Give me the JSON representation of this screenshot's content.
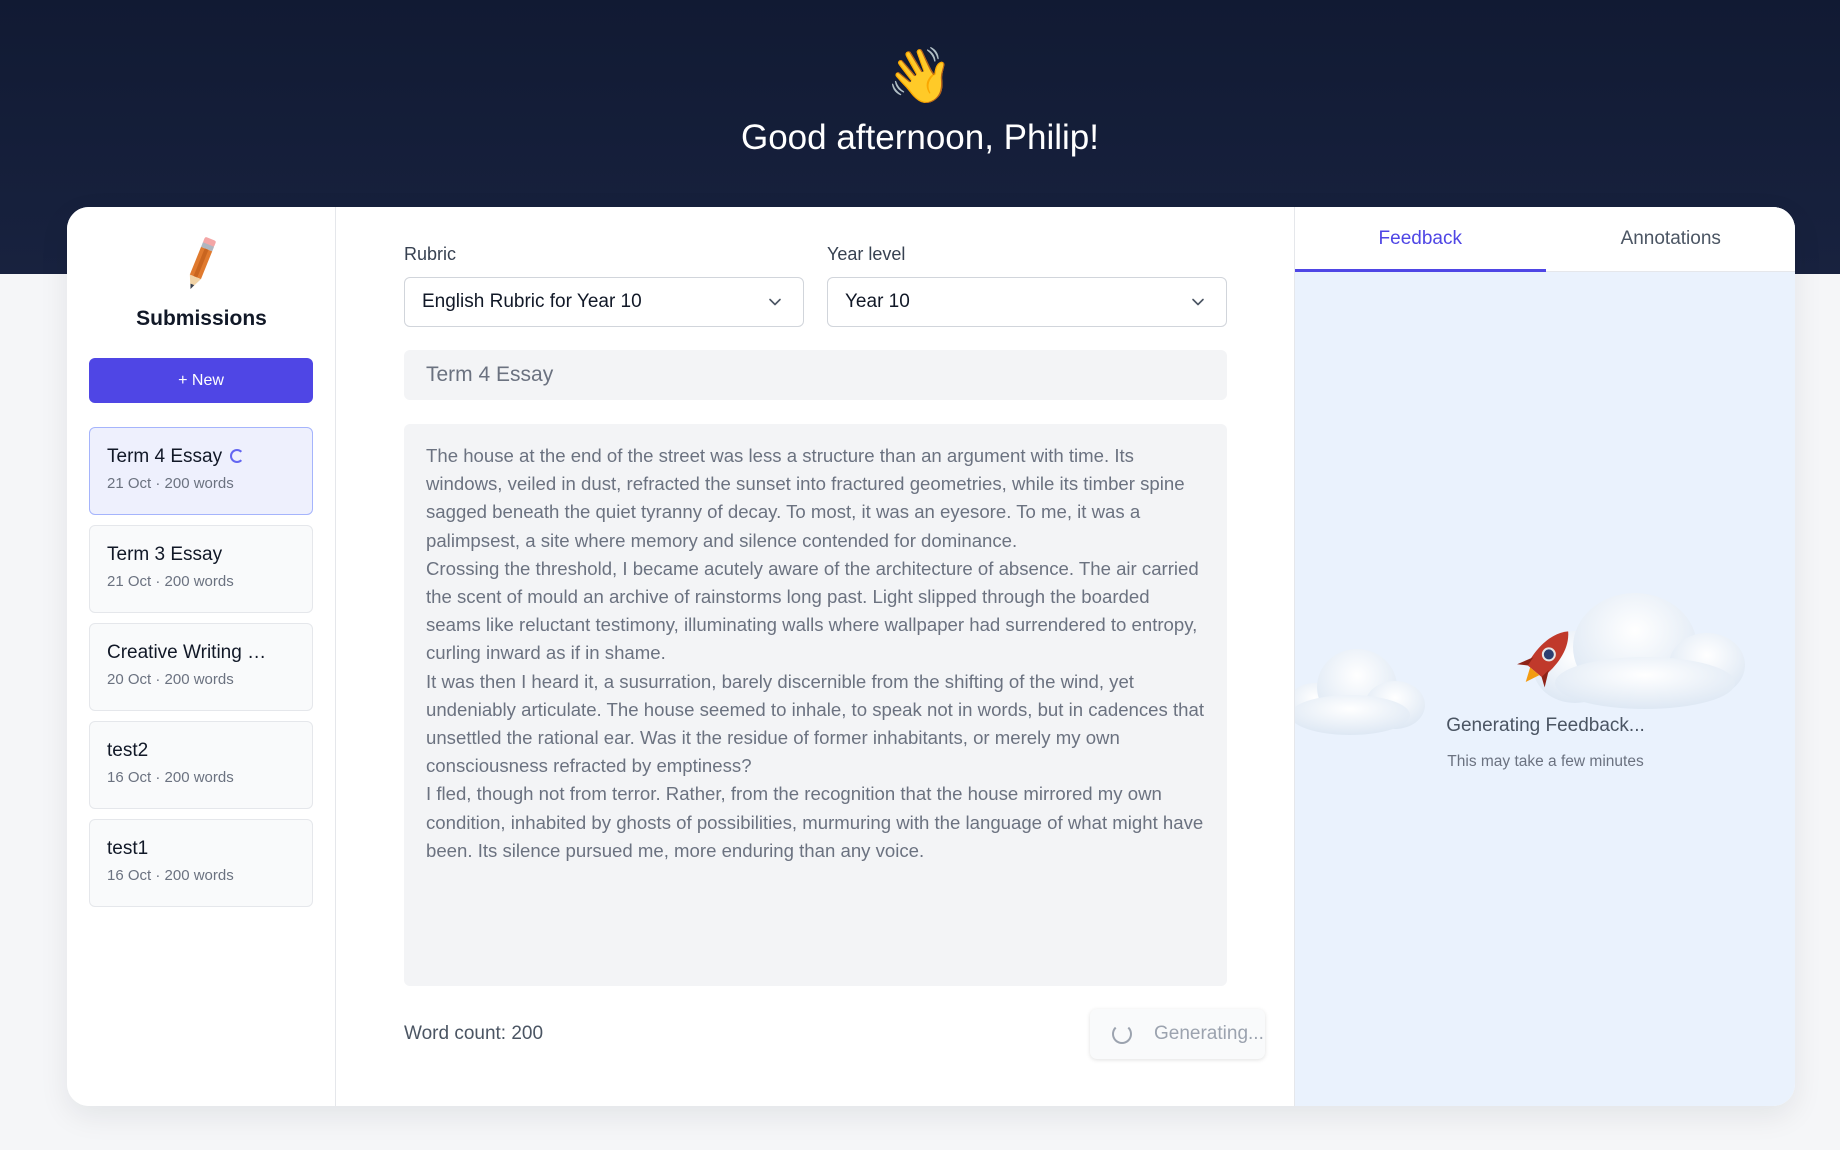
{
  "header": {
    "wave_emoji": "👋",
    "greeting": "Good afternoon, Philip!"
  },
  "sidebar": {
    "title": "Submissions",
    "new_button": "+ New",
    "items": [
      {
        "title": "Term 4 Essay",
        "meta": "21 Oct · 200 words",
        "active": true,
        "loading": true
      },
      {
        "title": "Term 3 Essay",
        "meta": "21 Oct · 200 words"
      },
      {
        "title": "Creative Writing …",
        "meta": "20 Oct · 200 words"
      },
      {
        "title": "test2",
        "meta": "16 Oct · 200 words"
      },
      {
        "title": "test1",
        "meta": "16 Oct · 200 words"
      }
    ]
  },
  "form": {
    "rubric_label": "Rubric",
    "rubric_value": "English Rubric for Year 10",
    "year_label": "Year level",
    "year_value": "Year 10",
    "title_value": "Term 4 Essay",
    "essay_paragraphs": [
      "The house at the end of the street was less a structure than an argument with time. Its windows, veiled in dust, refracted the sunset into fractured geometries, while its timber spine sagged beneath the quiet tyranny of decay. To most, it was an eyesore. To me, it was a palimpsest, a site where memory and silence contended for dominance.",
      "Crossing the threshold, I became acutely aware of the architecture of absence. The air carried the scent of mould an archive of rainstorms long past. Light slipped through the boarded seams like reluctant testimony, illuminating walls where wallpaper had surrendered to entropy, curling inward as if in shame.",
      "It was then I heard it, a susurration, barely discernible from the shifting of the wind, yet undeniably articulate. The house seemed to inhale, to speak not in words, but in cadences that unsettled the rational ear. Was it the residue of former inhabitants, or merely my own consciousness refracted by emptiness?",
      "I fled, though not from terror. Rather, from the recognition that the house mirrored my own condition, inhabited by ghosts of possibilities, murmuring with the language of what might have been. Its silence pursued me, more enduring than any voice."
    ],
    "word_count": "Word count: 200",
    "generate_button": "Generating..."
  },
  "panel": {
    "tabs": [
      "Feedback",
      "Annotations"
    ],
    "active_tab": "Feedback",
    "status_title": "Generating Feedback...",
    "status_sub": "This may take a few minutes"
  },
  "colors": {
    "hero": "#111a33",
    "accent": "#4f46e5",
    "panel_bg": "#eaf2fd"
  }
}
